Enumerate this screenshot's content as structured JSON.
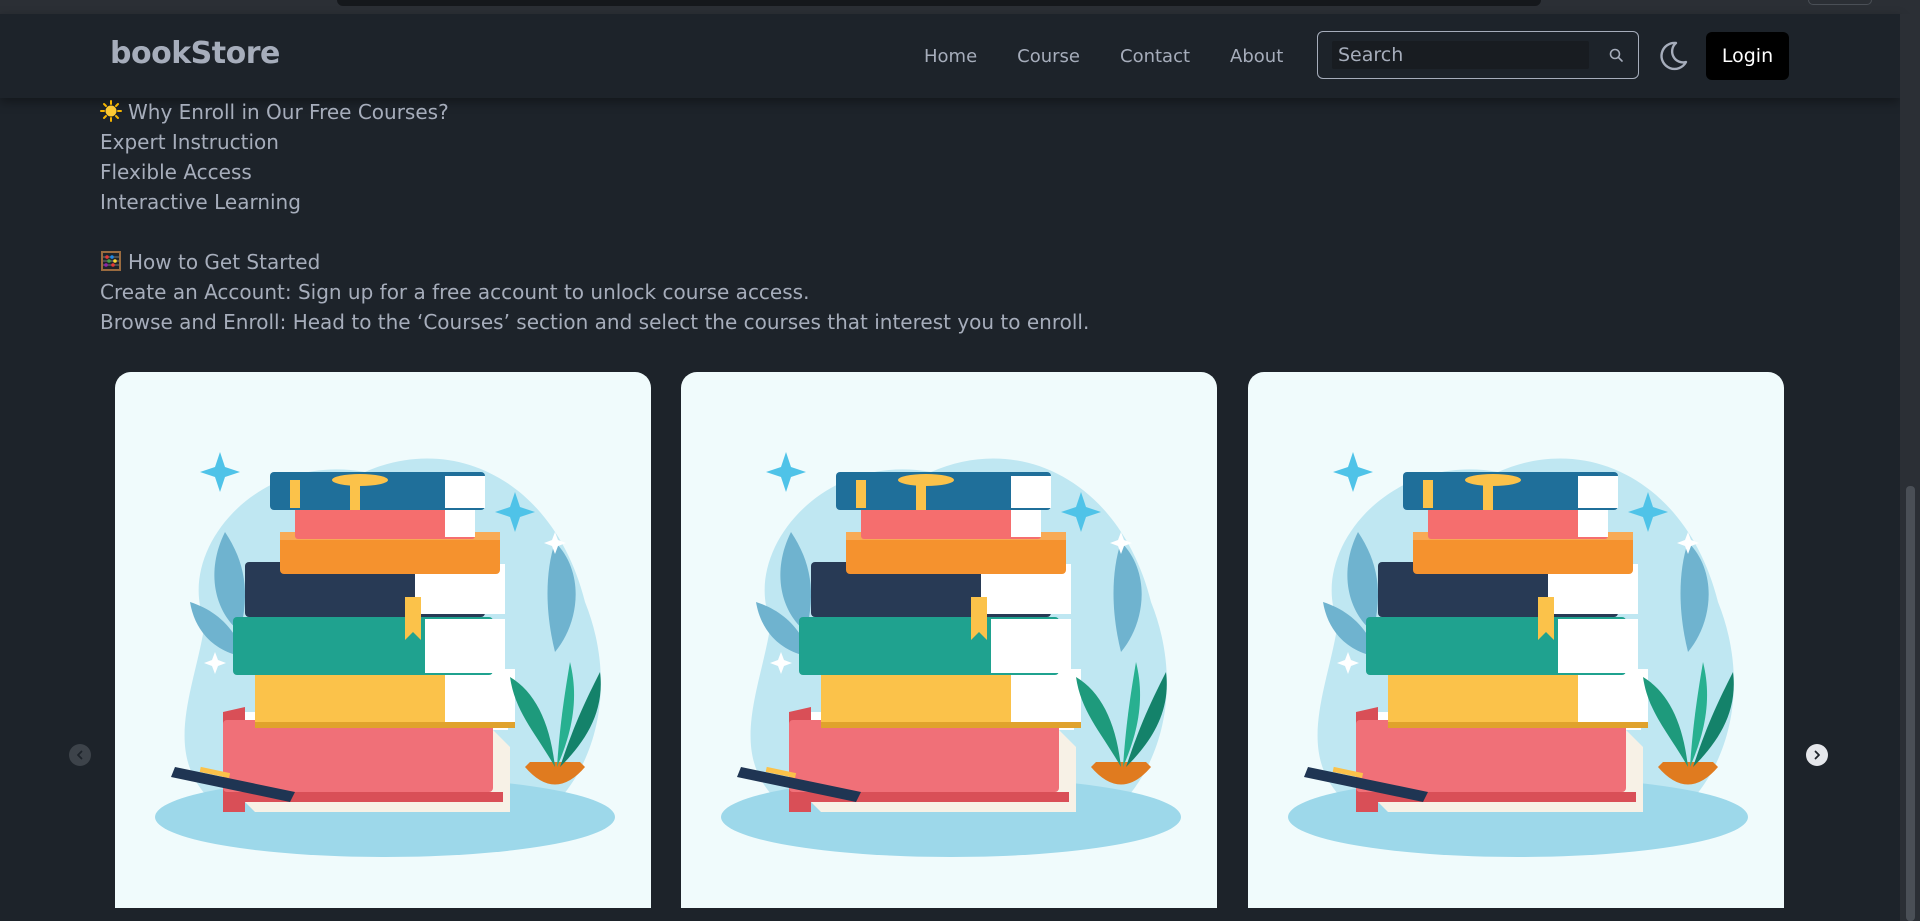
{
  "nav": {
    "brand": "bookStore",
    "links": [
      "Home",
      "Course",
      "Contact",
      "About"
    ],
    "search_placeholder": "Search",
    "login_label": "Login"
  },
  "content": {
    "why_heading": "Why Enroll in Our Free Courses?",
    "why_items": [
      "Expert Instruction",
      "Flexible Access",
      "Interactive Learning"
    ],
    "start_heading": "How to Get Started",
    "start_items": [
      "Create an Account: Sign up for a free account to unlock course access.",
      "Browse and Enroll: Head to the ‘Courses’ section and select the courses that interest you to enroll."
    ]
  },
  "carousel": {
    "card_count": 3,
    "prev_icon": "chevron-left-icon",
    "next_icon": "chevron-right-icon"
  },
  "colors": {
    "background": "#1d232a",
    "text": "#a6adbb",
    "card_background": "#f0fbfc",
    "login_button": "#000000"
  }
}
